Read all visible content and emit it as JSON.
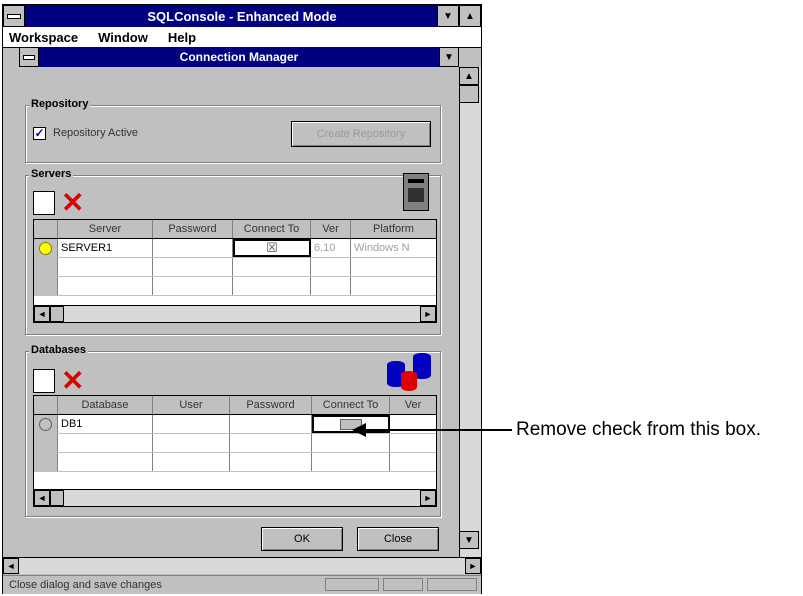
{
  "app": {
    "title": "SQLConsole - Enhanced Mode",
    "menu": [
      "Workspace",
      "Window",
      "Help"
    ]
  },
  "dialog": {
    "title": "Connection Manager",
    "repository": {
      "label": "Repository",
      "checkbox_label": "Repository Active",
      "checked": true,
      "create_button": "Create Repository"
    },
    "servers": {
      "label": "Servers",
      "columns": [
        "Server",
        "Password",
        "Connect To",
        "Ver",
        "Platform"
      ],
      "rows": [
        {
          "server": "SERVER1",
          "password": "",
          "connect_to": "☒",
          "ver": "6.10",
          "platform": "Windows N"
        }
      ]
    },
    "databases": {
      "label": "Databases",
      "columns": [
        "Database",
        "User",
        "Password",
        "Connect To",
        "Ver"
      ],
      "rows": [
        {
          "database": "DB1",
          "user": "",
          "password": "",
          "connect_to": "",
          "ver": ""
        }
      ]
    },
    "ok_button": "OK",
    "close_button": "Close"
  },
  "status_text": "Close dialog and save changes",
  "annotation": "Remove check from this box.",
  "colors": {
    "titlebar": "#000080",
    "face": "#c0c0c0",
    "delete_red": "#e00000"
  }
}
